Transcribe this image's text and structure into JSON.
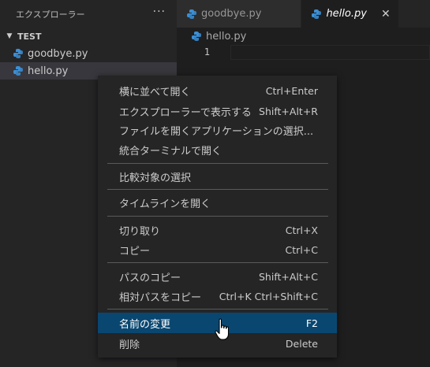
{
  "sidebar": {
    "title": "エクスプローラー",
    "more": "···",
    "section": "TEST",
    "files": [
      {
        "name": "goodbye.py"
      },
      {
        "name": "hello.py"
      }
    ]
  },
  "tabs": [
    {
      "label": "goodbye.py"
    },
    {
      "label": "hello.py",
      "close": "✕"
    }
  ],
  "editor": {
    "breadcrumb": "hello.py",
    "line_number": "1"
  },
  "menu": {
    "items": [
      {
        "label": "横に並べて開く",
        "key": "Ctrl+Enter"
      },
      {
        "label": "エクスプローラーで表示する",
        "key": "Shift+Alt+R"
      },
      {
        "label": "ファイルを開くアプリケーションの選択...",
        "key": ""
      },
      {
        "label": "統合ターミナルで開く",
        "key": ""
      },
      {
        "label": "比較対象の選択",
        "key": ""
      },
      {
        "label": "タイムラインを開く",
        "key": ""
      },
      {
        "label": "切り取り",
        "key": "Ctrl+X"
      },
      {
        "label": "コピー",
        "key": "Ctrl+C"
      },
      {
        "label": "パスのコピー",
        "key": "Shift+Alt+C"
      },
      {
        "label": "相対パスをコピー",
        "key": "Ctrl+K Ctrl+Shift+C"
      },
      {
        "label": "名前の変更",
        "key": "F2"
      },
      {
        "label": "削除",
        "key": "Delete"
      }
    ]
  },
  "colors": {
    "accent": "#094771",
    "python_icon_blue": "#3b8fd6",
    "python_icon_yellow": "#f2c84b"
  },
  "icons": {
    "file": "python-file-icon",
    "cursor": "hand-cursor-icon"
  }
}
